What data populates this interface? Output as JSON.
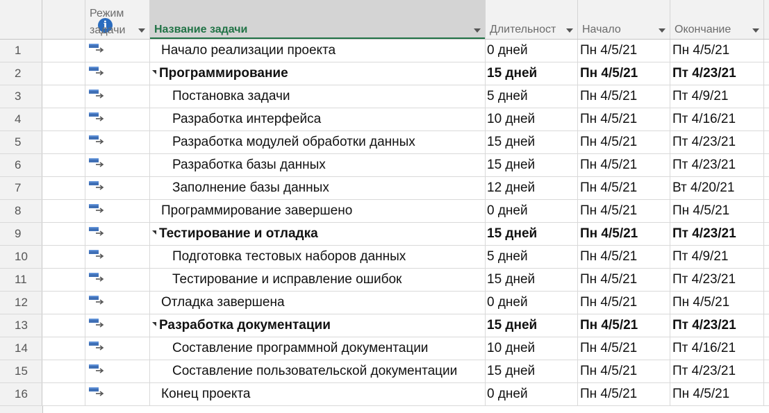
{
  "header": {
    "mode_line1": "Режим",
    "mode_line2": "задачи",
    "name": "Название задачи",
    "duration": "Длительност",
    "start": "Начало",
    "end": "Окончание"
  },
  "icons": {
    "info": "info-icon",
    "task_mode": "auto-scheduled-task-icon",
    "collapse": "collapse-triangle-icon"
  },
  "colors": {
    "accent": "#217346",
    "info": "#2a6cbf",
    "header_bg": "#f2f2f2"
  },
  "rows": [
    {
      "num": "1",
      "name": "Начало реализации проекта",
      "duration": "0 дней",
      "start": "Пн 4/5/21",
      "end": "Пн 4/5/21",
      "level": 1,
      "summary": false
    },
    {
      "num": "2",
      "name": "Программирование",
      "duration": "15 дней",
      "start": "Пн 4/5/21",
      "end": "Пт 4/23/21",
      "level": 1,
      "summary": true
    },
    {
      "num": "3",
      "name": "Постановка задачи",
      "duration": "5 дней",
      "start": "Пн 4/5/21",
      "end": "Пт 4/9/21",
      "level": 2,
      "summary": false
    },
    {
      "num": "4",
      "name": "Разработка интерфейса",
      "duration": "10 дней",
      "start": "Пн 4/5/21",
      "end": "Пт 4/16/21",
      "level": 2,
      "summary": false
    },
    {
      "num": "5",
      "name": "Разработка модулей обработки данных",
      "duration": "15 дней",
      "start": "Пн 4/5/21",
      "end": "Пт 4/23/21",
      "level": 2,
      "summary": false
    },
    {
      "num": "6",
      "name": "Разработка базы данных",
      "duration": "15 дней",
      "start": "Пн 4/5/21",
      "end": "Пт 4/23/21",
      "level": 2,
      "summary": false
    },
    {
      "num": "7",
      "name": "Заполнение базы данных",
      "duration": "12 дней",
      "start": "Пн 4/5/21",
      "end": "Вт 4/20/21",
      "level": 2,
      "summary": false
    },
    {
      "num": "8",
      "name": "Программирование завершено",
      "duration": "0 дней",
      "start": "Пн 4/5/21",
      "end": "Пн 4/5/21",
      "level": 1,
      "summary": false
    },
    {
      "num": "9",
      "name": "Тестирование и отладка",
      "duration": "15 дней",
      "start": "Пн 4/5/21",
      "end": "Пт 4/23/21",
      "level": 1,
      "summary": true
    },
    {
      "num": "10",
      "name": "Подготовка тестовых наборов данных",
      "duration": "5 дней",
      "start": "Пн 4/5/21",
      "end": "Пт 4/9/21",
      "level": 2,
      "summary": false
    },
    {
      "num": "11",
      "name": "Тестирование и исправление ошибок",
      "duration": "15 дней",
      "start": "Пн 4/5/21",
      "end": "Пт 4/23/21",
      "level": 2,
      "summary": false
    },
    {
      "num": "12",
      "name": "Отладка завершена",
      "duration": "0 дней",
      "start": "Пн 4/5/21",
      "end": "Пн 4/5/21",
      "level": 1,
      "summary": false
    },
    {
      "num": "13",
      "name": "Разработка документации",
      "duration": "15 дней",
      "start": "Пн 4/5/21",
      "end": "Пт 4/23/21",
      "level": 1,
      "summary": true
    },
    {
      "num": "14",
      "name": "Составление программной документации",
      "duration": "10 дней",
      "start": "Пн 4/5/21",
      "end": "Пт 4/16/21",
      "level": 2,
      "summary": false
    },
    {
      "num": "15",
      "name": "Составление пользовательской документации",
      "duration": "15 дней",
      "start": "Пн 4/5/21",
      "end": "Пт 4/23/21",
      "level": 2,
      "summary": false
    },
    {
      "num": "16",
      "name": "Конец проекта",
      "duration": "0 дней",
      "start": "Пн 4/5/21",
      "end": "Пн 4/5/21",
      "level": 1,
      "summary": false
    }
  ]
}
